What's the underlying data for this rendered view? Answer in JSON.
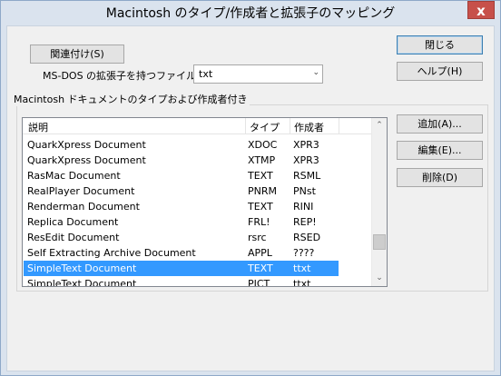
{
  "window": {
    "title": "Macintosh のタイプ/作成者と拡張子のマッピング",
    "close_glyph": "x"
  },
  "buttons": {
    "associate": "関連付け(S)",
    "close": "閉じる",
    "help": "ヘルプ(H)",
    "add": "追加(A)...",
    "edit": "編集(E)...",
    "delete": "削除(D)"
  },
  "extension": {
    "label": "MS-DOS の拡張子を持つファイル:",
    "value": "txt",
    "arrow": "⌄"
  },
  "group": {
    "title": "Macintosh ドキュメントのタイプおよび作成者付き"
  },
  "list": {
    "columns": [
      "説明",
      "タイプ",
      "作成者"
    ],
    "rows": [
      {
        "desc": "QuarkXpress Document",
        "type": "XDOC",
        "creator": "XPR3"
      },
      {
        "desc": "QuarkXpress Document",
        "type": "XTMP",
        "creator": "XPR3"
      },
      {
        "desc": "RasMac Document",
        "type": "TEXT",
        "creator": "RSML"
      },
      {
        "desc": "RealPlayer Document",
        "type": "PNRM",
        "creator": "PNst"
      },
      {
        "desc": "Renderman Document",
        "type": "TEXT",
        "creator": "RINI"
      },
      {
        "desc": "Replica Document",
        "type": "FRL!",
        "creator": "REP!"
      },
      {
        "desc": "ResEdit Document",
        "type": "rsrc",
        "creator": "RSED"
      },
      {
        "desc": "Self Extracting Archive Document",
        "type": "APPL",
        "creator": "????"
      },
      {
        "desc": "SimpleText Document",
        "type": "TEXT",
        "creator": "ttxt"
      },
      {
        "desc": "SimpleText Document",
        "type": "PICT",
        "creator": "ttxt"
      }
    ],
    "selected_index": 8,
    "scroll_up": "⌃",
    "scroll_down": "⌄"
  }
}
